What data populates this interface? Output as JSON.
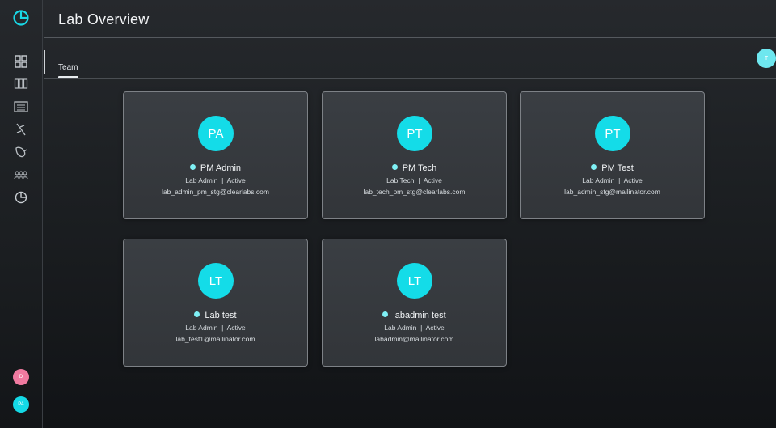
{
  "header": {
    "title": "Lab Overview"
  },
  "tabs": [
    {
      "label": "Team",
      "active": true
    }
  ],
  "sidebar": {
    "icons": [
      "dashboard-icon",
      "runs-icon",
      "plates-icon",
      "pipette-icon",
      "bacteria-icon",
      "team-icon",
      "reports-icon"
    ],
    "bottom_avatars": [
      {
        "initials": "D",
        "color": "#f07aa0"
      },
      {
        "initials": "PA",
        "color": "#14d9e6"
      }
    ]
  },
  "top_right_avatar": {
    "initials": "T",
    "color": "#6ee7ef"
  },
  "accent_color": "#14dce8",
  "team": [
    {
      "initials": "PA",
      "name": "PM Admin",
      "role": "Lab Admin",
      "status": "Active",
      "email": "lab_admin_pm_stg@clearlabs.com"
    },
    {
      "initials": "PT",
      "name": "PM Tech",
      "role": "Lab Tech",
      "status": "Active",
      "email": "lab_tech_pm_stg@clearlabs.com"
    },
    {
      "initials": "PT",
      "name": "PM Test",
      "role": "Lab Admin",
      "status": "Active",
      "email": "lab_admin_stg@mailinator.com"
    },
    {
      "initials": "LT",
      "name": "Lab test",
      "role": "Lab Admin",
      "status": "Active",
      "email": "lab_test1@mailinator.com"
    },
    {
      "initials": "LT",
      "name": "labadmin test",
      "role": "Lab Admin",
      "status": "Active",
      "email": "labadmin@mailinator.com"
    }
  ]
}
